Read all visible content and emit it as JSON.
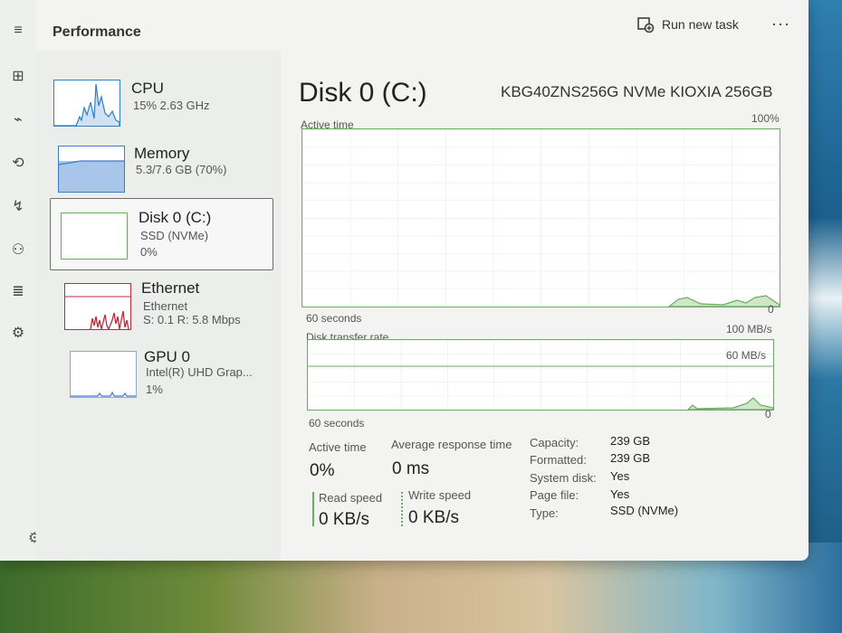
{
  "header": {
    "title": "Performance",
    "run_task": "Run new task",
    "more": "···"
  },
  "nav": {
    "menu": "≡",
    "processes": "⊞",
    "performance": "⌁",
    "history": "⟲",
    "startup": "↯",
    "users": "⚇",
    "details": "≣",
    "services": "⚙",
    "settings": "⚙"
  },
  "sidebar": {
    "items": [
      {
        "title": "CPU",
        "sub1": "15% 2.63 GHz",
        "sub2": "",
        "sub3": ""
      },
      {
        "title": "Memory",
        "sub1": "5.3/7.6 GB (70%)",
        "sub2": "",
        "sub3": ""
      },
      {
        "title": "Disk 0 (C:)",
        "sub1": "SSD (NVMe)",
        "sub2": "0%",
        "sub3": ""
      },
      {
        "title": "Ethernet",
        "sub1": "Ethernet",
        "sub2": "S: 0.1 R: 5.8 Mbps",
        "sub3": ""
      },
      {
        "title": "GPU 0",
        "sub1": "Intel(R) UHD Grap...",
        "sub2": "1%",
        "sub3": ""
      }
    ]
  },
  "main": {
    "title": "Disk 0 (C:)",
    "model": "KBG40ZNS256G NVMe KIOXIA 256GB",
    "active_time_graph": {
      "label": "Active time",
      "max": "100%",
      "min": "0",
      "duration": "60 seconds"
    },
    "transfer_graph": {
      "label": "Disk transfer rate",
      "max": "100 MB/s",
      "mid": "60 MB/s",
      "min": "0",
      "duration": "60 seconds"
    },
    "stats": {
      "active_time_label": "Active time",
      "active_time_value": "0%",
      "avg_response_label": "Average response time",
      "avg_response_value": "0 ms",
      "read_label": "Read speed",
      "read_value": "0 KB/s",
      "write_label": "Write speed",
      "write_value": "0 KB/s"
    },
    "info": [
      {
        "key": "Capacity:",
        "value": "239 GB"
      },
      {
        "key": "Formatted:",
        "value": "239 GB"
      },
      {
        "key": "System disk:",
        "value": "Yes"
      },
      {
        "key": "Page file:",
        "value": "Yes"
      },
      {
        "key": "Type:",
        "value": "SSD (NVMe)"
      }
    ]
  },
  "colors": {
    "disk_green": "#6cab63",
    "cpu_blue": "#2e7fc4",
    "ethernet_red": "#c2283a",
    "gpu_blue": "#3f7dd8"
  }
}
